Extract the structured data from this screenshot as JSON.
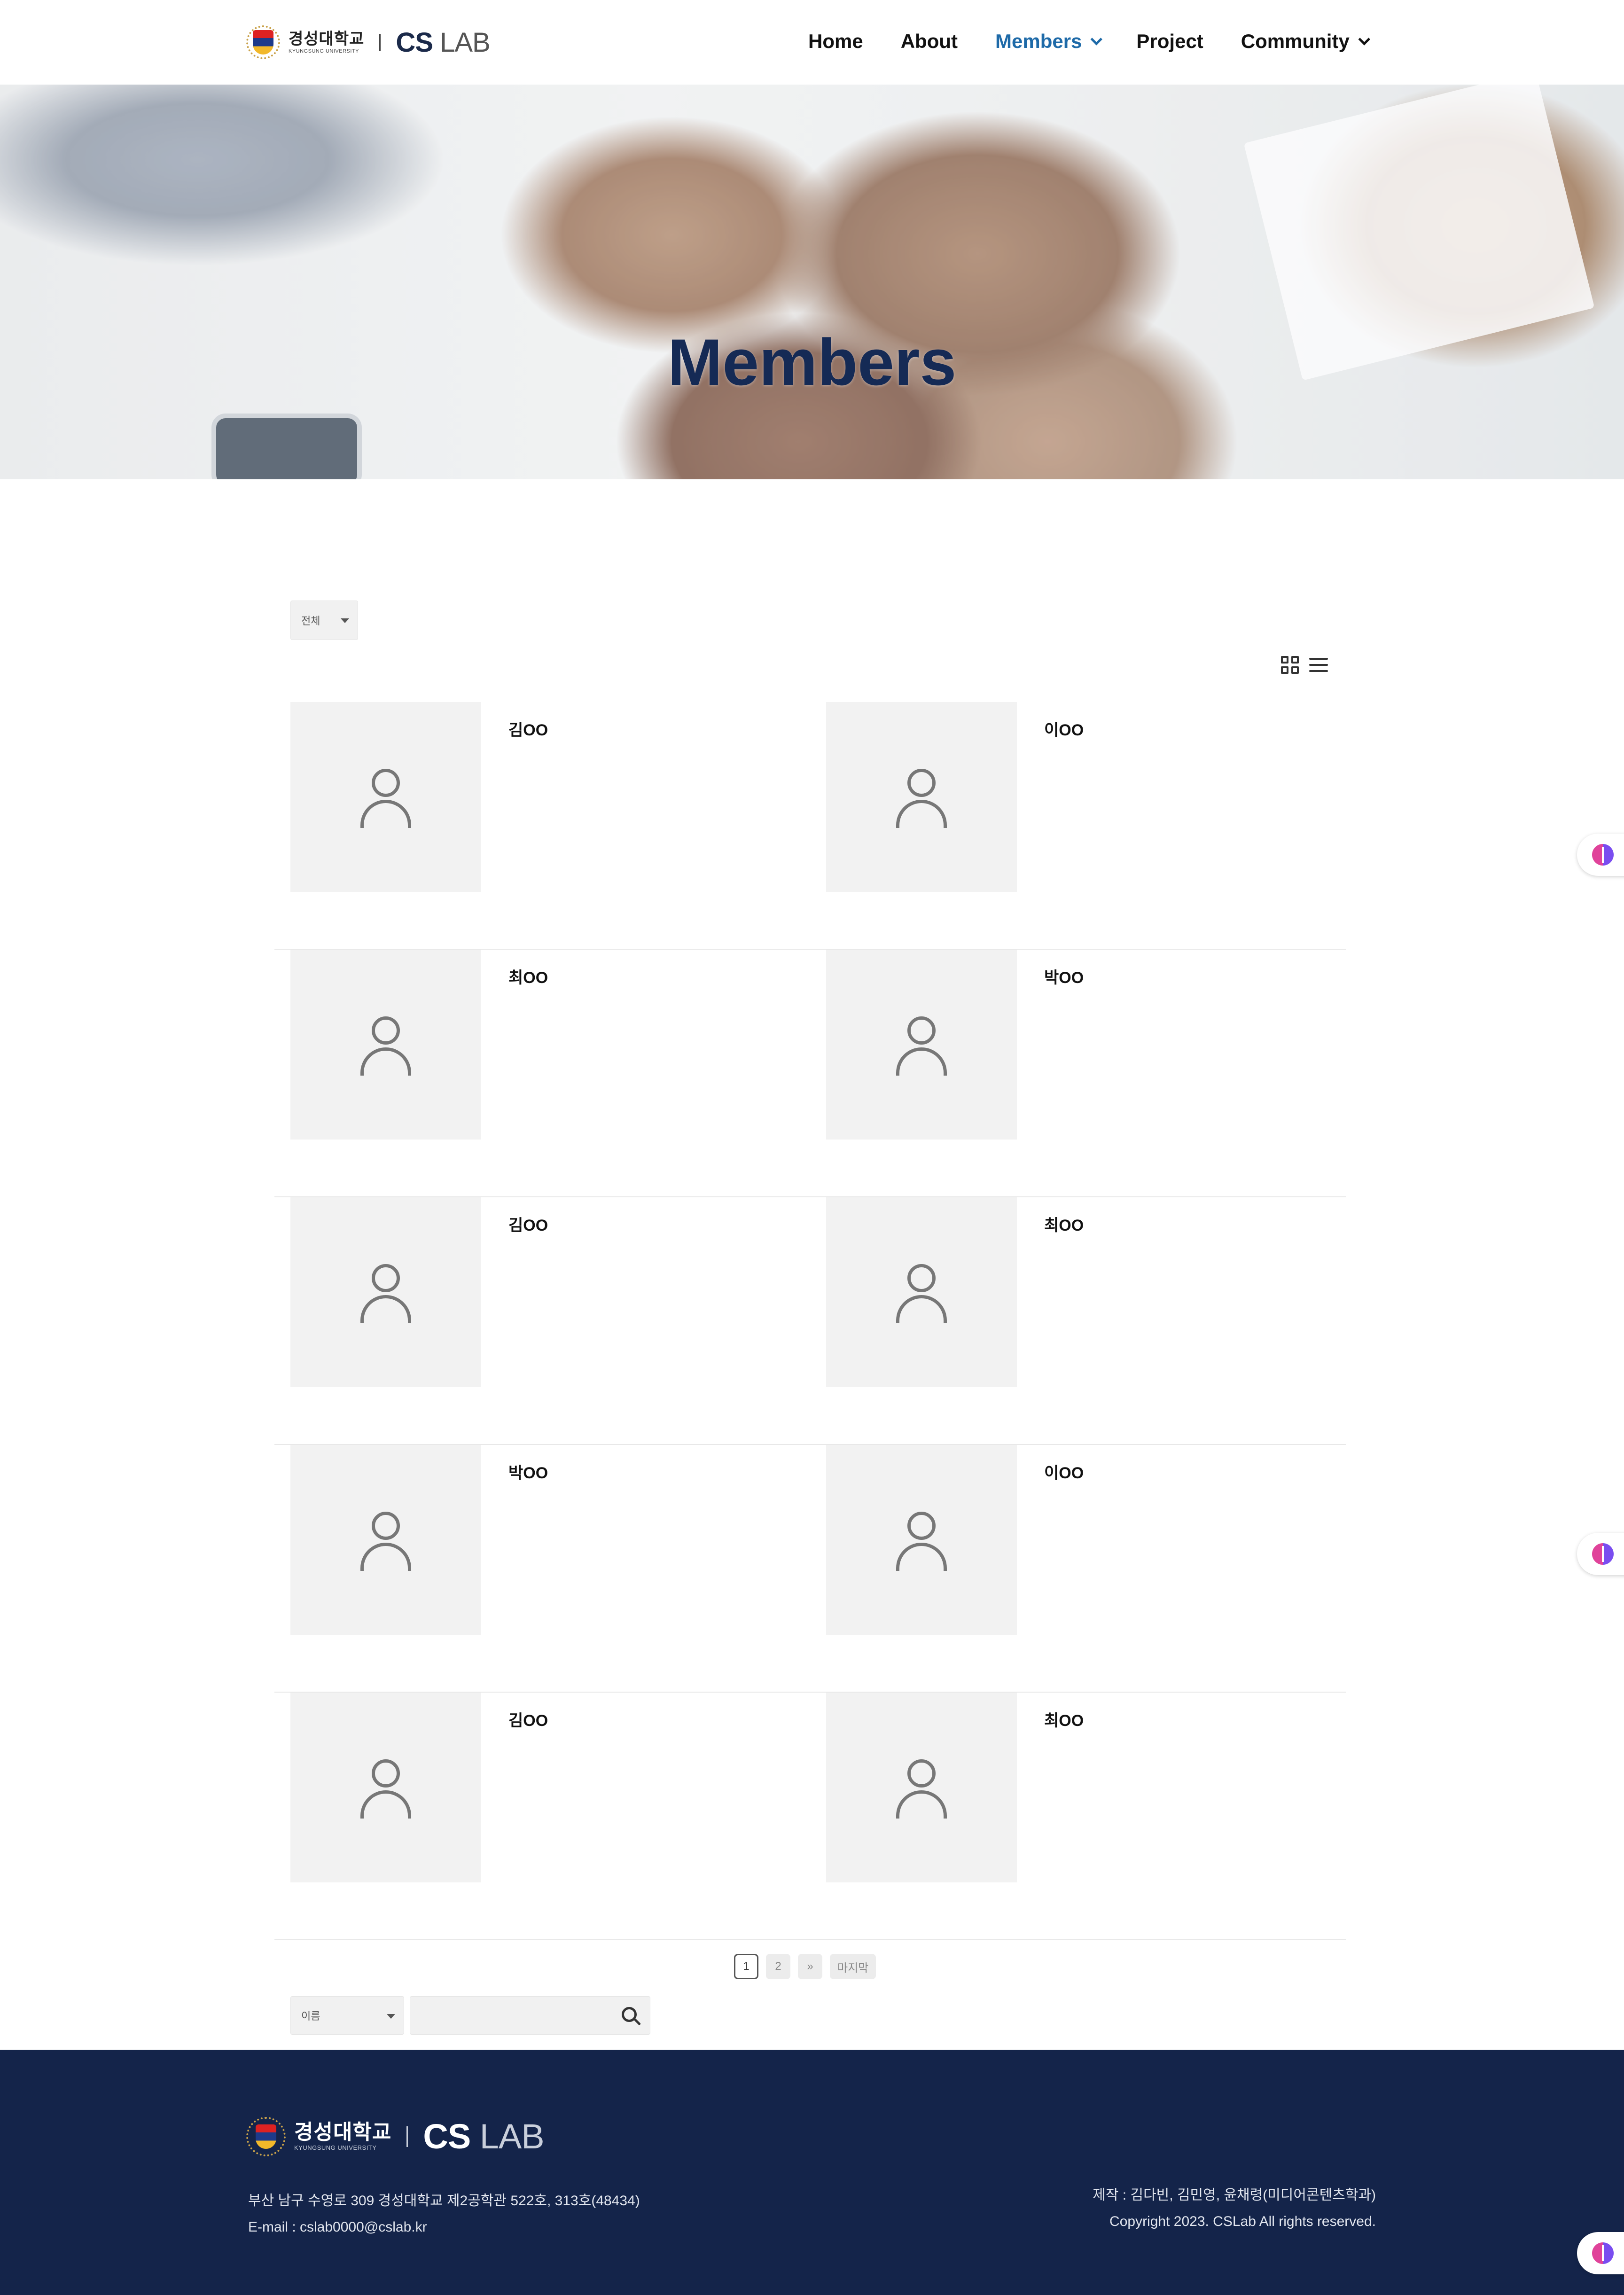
{
  "header": {
    "logo": {
      "university_ko": "경성대학교",
      "university_en": "KYUNGSUNG UNIVERSITY",
      "lab_bold": "CS",
      "lab_light": "LAB"
    },
    "nav": [
      {
        "label": "Home",
        "active": false
      },
      {
        "label": "About",
        "active": false
      },
      {
        "label": "Members",
        "active": true,
        "has_dropdown": true
      },
      {
        "label": "Project",
        "active": false
      },
      {
        "label": "Community",
        "active": false,
        "has_dropdown": true
      }
    ]
  },
  "hero": {
    "title": "Members"
  },
  "filter": {
    "selected": "전체"
  },
  "view_toggle": {
    "grid_icon": "grid-icon",
    "list_icon": "list-icon"
  },
  "members": [
    {
      "name": "김OO"
    },
    {
      "name": "이OO"
    },
    {
      "name": "최OO"
    },
    {
      "name": "박OO"
    },
    {
      "name": "김OO"
    },
    {
      "name": "최OO"
    },
    {
      "name": "박OO"
    },
    {
      "name": "이OO"
    },
    {
      "name": "김OO"
    },
    {
      "name": "최OO"
    }
  ],
  "pagination": {
    "pages": [
      "1",
      "2"
    ],
    "current": "1",
    "next": "»",
    "last": "마지막"
  },
  "search": {
    "field_selected": "이름",
    "query": ""
  },
  "footer": {
    "address": "부산 남구 수영로 309 경성대학교 제2공학관 522호, 313호(48434)",
    "email": "E-mail : cslab0000@cslab.kr",
    "credits": "제작 : 김다빈, 김민영, 윤채령(미디어콘텐츠학과)",
    "copyright": "Copyright 2023. CSLab All rights reserved."
  },
  "colors": {
    "nav_active": "#1e6aa8",
    "hero_title": "#152a55",
    "footer_bg": "#14244a"
  }
}
